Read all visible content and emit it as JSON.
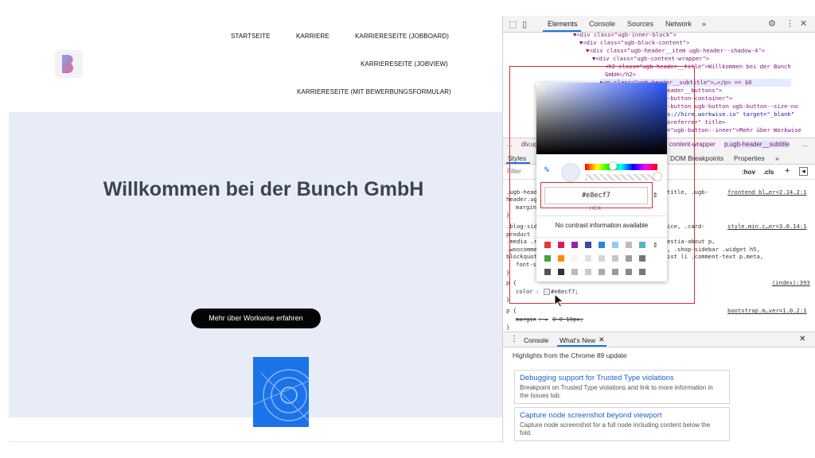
{
  "site": {
    "nav": [
      "STARTSEITE",
      "KARRIERE",
      "KARRIERESEITE (JOBBOARD)",
      "KARRIERESEITE (JOBVIEW)",
      "KARRIERESEITE (MIT BEWERBUNGSFORMULAR)"
    ],
    "hero_title": "Willkommen bei der Bunch GmbH",
    "hero_button": "Mehr über Workwise erfahren",
    "hero_bg": "#e8ecf7"
  },
  "devtools": {
    "tabs": [
      "Elements",
      "Console",
      "Sources",
      "Network",
      "»"
    ],
    "dom_lines": [
      {
        "text": "▼<div class=\"ugb-inner-block\">"
      },
      {
        "text": "▼<div class=\"ugb-block-content\">"
      },
      {
        "text": "▼<div class=\"ugb-header__item ugb-header--shadow-4\">"
      },
      {
        "text": "▼<div class=\"ugb-content-wrapper\">"
      },
      {
        "text": "<h2 class=\"ugb-header__title\">Willkommen bei der Bunch"
      },
      {
        "text": "GmbH</h2>"
      },
      {
        "text": "▶<p class=\"ugb-header__subtitle\">…</p> == $0"
      },
      {
        "text": "eader__buttons\">"
      },
      {
        "text": "-button-container\">"
      },
      {
        "text": "-button ugb-button ugb-button--size-no"
      },
      {
        "text": "s://hire.workwise.io\" target=\"_blank\""
      },
      {
        "text": "oreferrer\" title>"
      },
      {
        "text": "=\"ugb-button--inner\">Mehr über Workwise"
      }
    ],
    "breadcrumbs": [
      "...",
      "div.ug",
      "content-wrapper",
      "p.ugb-header__subtitle",
      "..."
    ],
    "styles_tabs": [
      "Styles",
      "DOM Breakpoints",
      "Properties",
      "»"
    ],
    "filter_placeholder": "Filter",
    "filter_tools": [
      ":hov",
      ".cls",
      "+"
    ],
    "rules": [
      {
        "selector": ".ugb-head",
        "selector2": "header.ug",
        "matched": "title, .ugb-",
        "prop": "margin",
        "source": "frontend_bl…er=2.14.2:1"
      },
      {
        "selector": ".blog-sid",
        "selector2": "product ",
        "matched": "ice, .card-",
        "line2": ".media .r",
        "line2b": "estia-about p,",
        "line3": ".woocomme",
        "line3b": ", .shop-sidebar .widget h5,",
        "line4": "blockquot",
        "line4b": "ist li .comment-text p.meta,",
        "prop": "font-s",
        "source": "style.min.c…er=3.0.14:1"
      },
      {
        "selector": "p {",
        "prop": "color",
        "value": "#e8ecf7;",
        "source": "(index):393"
      },
      {
        "selector": "p {",
        "prop": "margin",
        "value": "0 0 10px;",
        "source": "bootstrap.m…ver=1.0.2:1"
      }
    ],
    "drawer": {
      "tabs": [
        "Console",
        "What's New"
      ],
      "highlights": "Highlights from the Chrome 89 update",
      "cards": [
        {
          "title": "Debugging support for Trusted Type violations",
          "desc": "Breakpoint on Trusted Type violations and link to more information in the Issues tab."
        },
        {
          "title": "Capture node screenshot beyond viewport",
          "desc": "Capture node screenshot for a full node including content below the fold."
        }
      ]
    }
  },
  "picker": {
    "hex": "#e8ecf7",
    "hex_label": "HEX",
    "contrast": "No contrast information available",
    "palette": [
      "#e53935",
      "#d81b60",
      "#8e24aa",
      "#3949ab",
      "#1e88e5",
      "#90caf9",
      "#bdbdbd",
      "#4fb6c9",
      "#43a047",
      "#fb8c00",
      "#f5f5f5",
      "#e0e0e0",
      "#d5d5d5",
      "#c8c8c8",
      "#9e9e9e",
      "#757575",
      "#555555",
      "#333333",
      "#bbbbbb",
      "#c9c9c9",
      "#aaaaaa",
      "#999999",
      "#888888",
      "#777777"
    ]
  },
  "colors": {
    "accent": "#1a73e8",
    "highlight": "#d62f2f"
  }
}
